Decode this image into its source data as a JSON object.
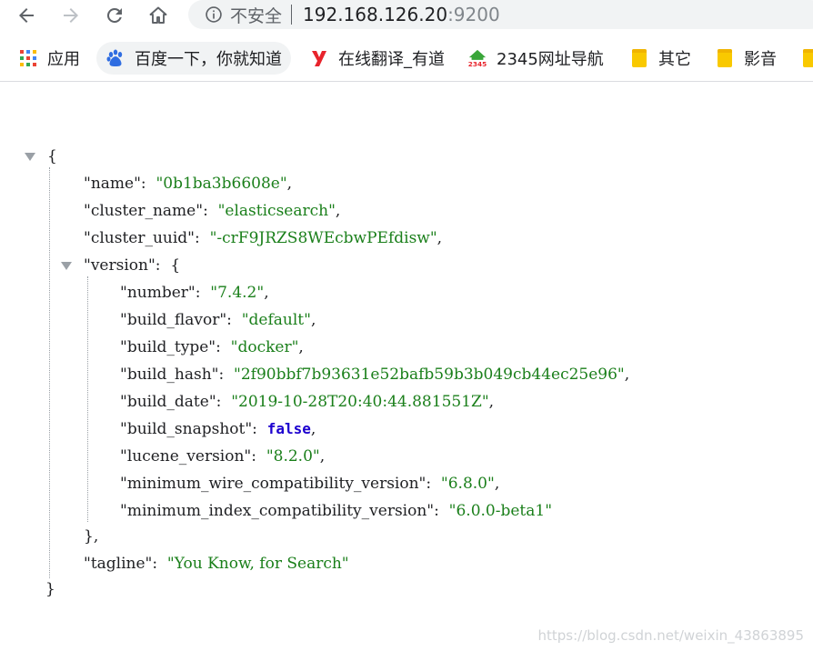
{
  "toolbar": {
    "back_icon": "back-arrow-icon",
    "forward_icon": "forward-arrow-icon",
    "reload_icon": "reload-icon",
    "home_icon": "home-icon",
    "security_label": "不安全",
    "url_host": "192.168.126.20",
    "url_port": ":9200"
  },
  "bookmarks": [
    {
      "label": "应用",
      "icon": "apps-grid-icon"
    },
    {
      "label": "百度一下，你就知道",
      "icon": "baidu-paw-icon"
    },
    {
      "label": "在线翻译_有道",
      "icon": "youdao-icon"
    },
    {
      "label": "2345网址导航",
      "icon": "2345-house-icon"
    },
    {
      "label": "其它",
      "icon": "folder-icon"
    },
    {
      "label": "影音",
      "icon": "folder-icon"
    }
  ],
  "json": {
    "open_brace": "{",
    "close_brace": "}",
    "entries": [
      {
        "key": "\"name\"",
        "value": "\"0b1ba3b6608e\""
      },
      {
        "key": "\"cluster_name\"",
        "value": "\"elasticsearch\""
      },
      {
        "key": "\"cluster_uuid\"",
        "value": "\"-crF9JRZS8WEcbwPEfdisw\""
      }
    ],
    "version_key": "\"version\"",
    "version_entries": [
      {
        "key": "\"number\"",
        "value": "\"7.4.2\""
      },
      {
        "key": "\"build_flavor\"",
        "value": "\"default\""
      },
      {
        "key": "\"build_type\"",
        "value": "\"docker\""
      },
      {
        "key": "\"build_hash\"",
        "value": "\"2f90bbf7b93631e52bafb59b3b049cb44ec25e96\""
      },
      {
        "key": "\"build_date\"",
        "value": "\"2019-10-28T20:40:44.881551Z\""
      },
      {
        "key": "\"build_snapshot\"",
        "value": "false"
      },
      {
        "key": "\"lucene_version\"",
        "value": "\"8.2.0\""
      },
      {
        "key": "\"minimum_wire_compatibility_version\"",
        "value": "\"6.8.0\""
      },
      {
        "key": "\"minimum_index_compatibility_version\"",
        "value": "\"6.0.0-beta1\""
      }
    ],
    "version_close": "},",
    "tagline_key": "\"tagline\"",
    "tagline_value": "\"You Know, for Search\""
  },
  "watermark": "https://blog.csdn.net/weixin_43863895",
  "colors": {
    "string": "#1a7f1a",
    "boolean": "#1c00cf",
    "omnibox_bg": "#f1f3f4"
  }
}
